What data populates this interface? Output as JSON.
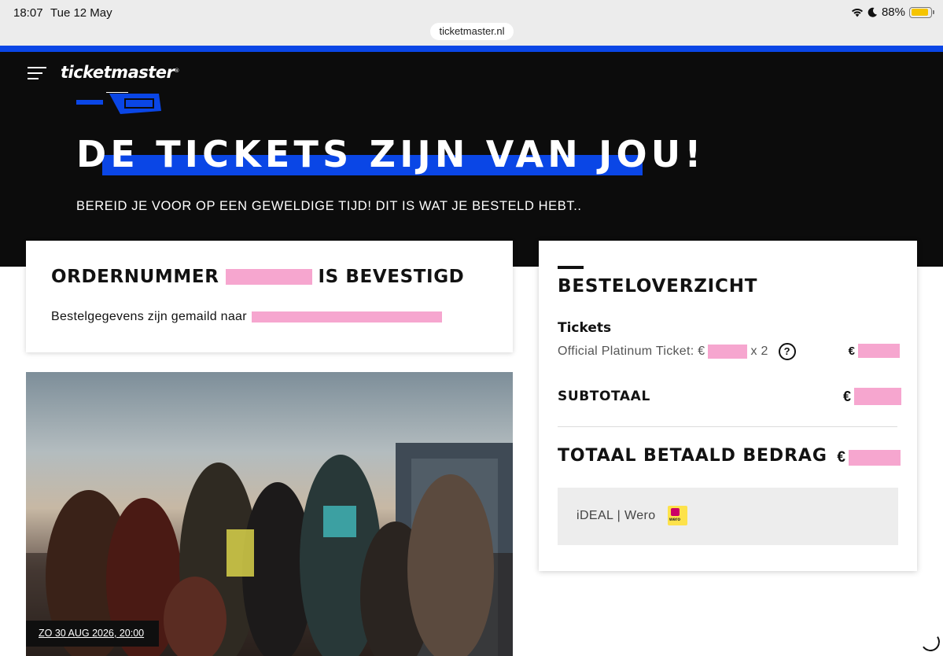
{
  "status_bar": {
    "time": "18:07",
    "date": "Tue 12 May",
    "battery": "88%",
    "battery_level": 0.88,
    "icons": [
      "wifi-icon",
      "moon-icon",
      "battery-icon"
    ]
  },
  "browser": {
    "url": "ticketmaster.nl"
  },
  "colors": {
    "brand_blue": "#0a46e6",
    "redaction_pink": "#f6a6cf",
    "hero_bg": "#0c0c0c"
  },
  "header": {
    "logo": "ticketmaster",
    "logo_mark": "®",
    "menu_icon": "hamburger-icon"
  },
  "hero": {
    "title": "DE TICKETS ZIJN VAN JOU!",
    "subtitle": "BEREID JE VOOR OP EEN GEWELDIGE TIJD! DIT IS WAT JE BESTELD HEBT.."
  },
  "order": {
    "title_prefix": "ORDERNUMMER",
    "title_suffix": "IS BEVESTIGD",
    "email_text": "Bestelgegevens zijn gemaild naar"
  },
  "event": {
    "date": "ZO 30 AUG 2026, 20:00"
  },
  "summary": {
    "title": "BESTELOVERZICHT",
    "tickets_heading": "Tickets",
    "ticket_item_prefix": "Official Platinum Ticket: €",
    "ticket_item_qty": "x 2",
    "help_symbol": "?",
    "currency": "€",
    "subtotal_label": "SUBTOTAAL",
    "total_label": "TOTAAL BETAALD BEDRAG",
    "payment_method": "iDEAL | Wero",
    "payment_logo_text": "wero"
  }
}
